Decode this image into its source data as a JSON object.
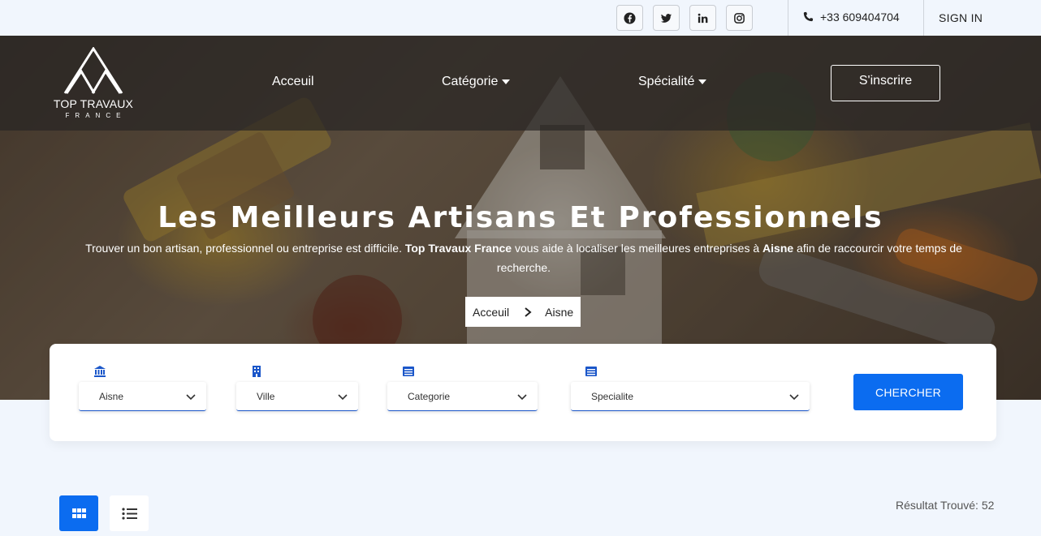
{
  "topbar": {
    "social": [
      "facebook-icon",
      "twitter-icon",
      "linkedin-icon",
      "instagram-icon"
    ],
    "phone": "+33 609404704",
    "signin": "SIGN IN"
  },
  "nav": {
    "logo_text": "TOP TRAVAUX",
    "logo_sub": "FRANCE",
    "links": [
      "Acceuil",
      "Catégorie",
      "Spécialité"
    ],
    "signup": "S'inscrire"
  },
  "hero": {
    "title": "Les Meilleurs Artisans Et Professionnels",
    "desc_1": "Trouver un bon artisan, professionnel ou entreprise est difficile. ",
    "desc_brand": "Top Travaux France",
    "desc_2": " vous aide à localiser les meilleures entreprises à ",
    "desc_city": "Aisne",
    "desc_3": " afin de raccourcir votre temps de recherche.",
    "breadcrumb": [
      "Acceuil",
      "Aisne"
    ]
  },
  "search": {
    "region": "Aisne",
    "ville": "Ville",
    "categorie": "Categorie",
    "specialite": "Specialite",
    "button": "CHERCHER"
  },
  "results": {
    "label": "Résultat Trouvé: 52"
  },
  "colors": {
    "accent": "#0b6cf0",
    "background": "#f1f6fd"
  }
}
